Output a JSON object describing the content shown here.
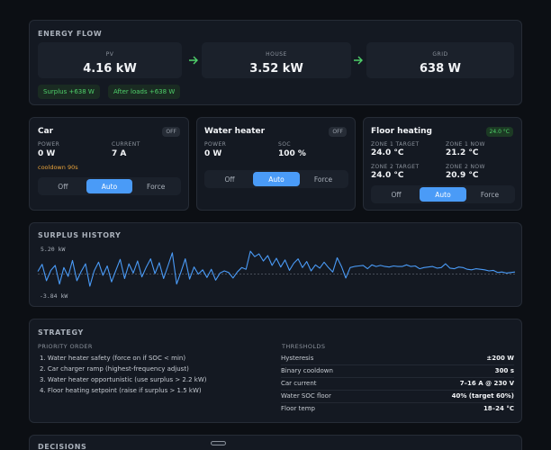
{
  "energy_flow": {
    "title": "ENERGY FLOW",
    "pv": {
      "label": "PV",
      "value": "4.16 kW"
    },
    "house": {
      "label": "HOUSE",
      "value": "3.52 kW"
    },
    "grid": {
      "label": "GRID",
      "value": "638 W"
    },
    "surplus_chip": "Surplus +638 W",
    "after_loads_chip": "After loads +638 W",
    "accent": "#4fd16a"
  },
  "car": {
    "title": "Car",
    "badge": "OFF",
    "power_label": "POWER",
    "power_value": "0 W",
    "current_label": "CURRENT",
    "current_value": "7 A",
    "cooldown": "cooldown 90s",
    "modes": [
      "Off",
      "Auto",
      "Force"
    ],
    "selected_mode": "Auto"
  },
  "water_heater": {
    "title": "Water heater",
    "badge": "OFF",
    "power_label": "POWER",
    "power_value": "0 W",
    "soc_label": "SOC",
    "soc_value": "100 %",
    "modes": [
      "Off",
      "Auto",
      "Force"
    ],
    "selected_mode": "Auto"
  },
  "floor_heating": {
    "title": "Floor heating",
    "badge": "24.0 °C",
    "zone1_target_label": "ZONE 1 TARGET",
    "zone1_target_value": "24.0 °C",
    "zone1_now_label": "ZONE 1 NOW",
    "zone1_now_value": "21.2 °C",
    "zone2_target_label": "ZONE 2 TARGET",
    "zone2_target_value": "24.0 °C",
    "zone2_now_label": "ZONE 2 NOW",
    "zone2_now_value": "20.9 °C",
    "modes": [
      "Off",
      "Auto",
      "Force"
    ],
    "selected_mode": "Auto"
  },
  "surplus_history": {
    "title": "SURPLUS HISTORY",
    "max_label": "5.20 kW",
    "min_label": "-3.84 kW",
    "line_color": "#4a9bf7"
  },
  "chart_data": {
    "type": "line",
    "ylim": [
      -3.84,
      5.2
    ],
    "series": [
      {
        "values": [
          0.5,
          1.8,
          -1.2,
          0.7,
          1.6,
          -1.8,
          1.2,
          -0.4,
          2.5,
          -1.2,
          0.5,
          1.9,
          -2.2,
          0.6,
          2.2,
          -0.2,
          1.5,
          -1.4,
          0.7,
          2.7,
          -0.8,
          1.9,
          0.2,
          2.4,
          -0.5,
          1.3,
          2.8,
          0.1,
          2.1,
          -0.8,
          1.5,
          3.9,
          -1.8,
          0.4,
          2.8,
          -0.9,
          1.3,
          0.0,
          0.8,
          -0.6,
          0.9,
          -1.1,
          0.2,
          0.6,
          0.3,
          -0.7,
          0.4,
          1.2,
          0.9,
          4.2,
          3.2,
          3.7,
          2.4,
          3.4,
          1.6,
          2.9,
          1.3,
          2.6,
          0.7,
          2.0,
          2.8,
          1.2,
          2.3,
          0.6,
          1.7,
          1.1,
          2.2,
          1.2,
          0.4,
          3.0,
          1.4,
          -0.7,
          1.2,
          1.4,
          1.5,
          1.6,
          1.0,
          1.7,
          1.4,
          1.6,
          1.4,
          1.3,
          1.5,
          1.4,
          1.4,
          1.7,
          1.4,
          1.5,
          1.0,
          1.2,
          1.3,
          1.4,
          1.1,
          1.2,
          1.9,
          1.1,
          1.0,
          1.3,
          1.2,
          0.9,
          0.8,
          1.0,
          0.9,
          0.8,
          0.6,
          0.7,
          0.3,
          0.4,
          0.2,
          0.3,
          0.4
        ]
      }
    ]
  },
  "strategy": {
    "title": "STRATEGY",
    "priority_heading": "PRIORITY ORDER",
    "priorities": [
      "1. Water heater safety (force on if SOC < min)",
      "2. Car charger ramp (highest-frequency adjust)",
      "3. Water heater opportunistic (use surplus > 2.2 kW)",
      "4. Floor heating setpoint (raise if surplus > 1.5 kW)"
    ],
    "thresholds_heading": "THRESHOLDS",
    "thresholds": [
      {
        "key": "Hysteresis",
        "value": "±200 W"
      },
      {
        "key": "Binary cooldown",
        "value": "300 s"
      },
      {
        "key": "Car current",
        "value": "7–16 A @ 230 V"
      },
      {
        "key": "Water SOC floor",
        "value": "40% (target 60%)"
      },
      {
        "key": "Floor temp",
        "value": "18–24 °C"
      }
    ]
  },
  "decisions": {
    "title": "DECISIONS"
  }
}
